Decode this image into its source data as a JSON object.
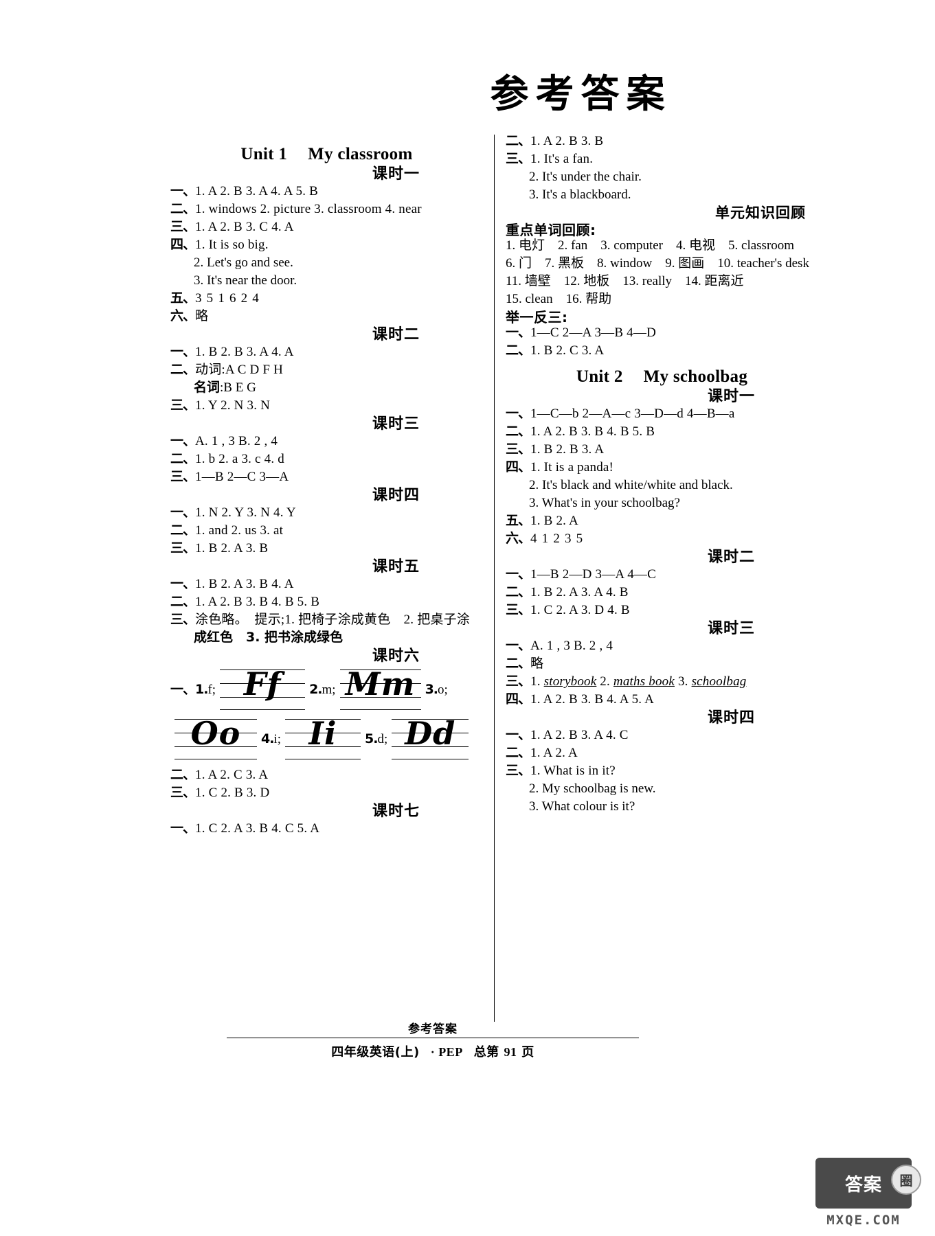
{
  "title": "参考答案",
  "left_column": [
    {
      "kind": "unit",
      "no": "Unit 1",
      "name": "My classroom"
    },
    {
      "kind": "lesson",
      "label": "课时一"
    },
    {
      "kind": "ans",
      "num": "一、",
      "body": "1. A   2. B   3. A   4. A   5. B"
    },
    {
      "kind": "ans",
      "num": "二、",
      "body": "1. windows   2. picture   3. classroom   4. near"
    },
    {
      "kind": "ans",
      "num": "三、",
      "body": "1. A   2. B   3. C   4. A"
    },
    {
      "kind": "ans",
      "num": "四、",
      "body": "1. It is so big."
    },
    {
      "kind": "cont",
      "body": "2. Let's go and see."
    },
    {
      "kind": "cont",
      "body": "3. It's near the door."
    },
    {
      "kind": "ans",
      "num": "五、",
      "body": "3   5   1   6   2   4"
    },
    {
      "kind": "ans_cn",
      "num": "六、",
      "body": "略"
    },
    {
      "kind": "lesson",
      "label": "课时二"
    },
    {
      "kind": "ans",
      "num": "一、",
      "body": "1. B   2. B   3. A   4. A"
    },
    {
      "kind": "ans_mix",
      "num": "二、",
      "cn": "动词",
      "body": ":A   C   D   F   H"
    },
    {
      "kind": "cont_mix",
      "cn": "名词",
      "body": ":B   E   G"
    },
    {
      "kind": "ans",
      "num": "三、",
      "body": "1. Y   2. N   3. N"
    },
    {
      "kind": "lesson",
      "label": "课时三"
    },
    {
      "kind": "ans",
      "num": "一、",
      "body": "A. 1 , 3   B. 2 , 4"
    },
    {
      "kind": "ans",
      "num": "二、",
      "body": "1. b   2. a   3. c   4. d"
    },
    {
      "kind": "ans",
      "num": "三、",
      "body": "1—B   2—C   3—A"
    },
    {
      "kind": "lesson",
      "label": "课时四"
    },
    {
      "kind": "ans",
      "num": "一、",
      "body": "1. N   2. Y   3. N   4. Y"
    },
    {
      "kind": "ans",
      "num": "二、",
      "body": "1. and   2. us   3. at"
    },
    {
      "kind": "ans",
      "num": "三、",
      "body": "1. B   2. A   3. B"
    },
    {
      "kind": "lesson",
      "label": "课时五"
    },
    {
      "kind": "ans",
      "num": "一、",
      "body": "1. B   2. A   3. B   4. A"
    },
    {
      "kind": "ans",
      "num": "二、",
      "body": "1. A   2. B   3. B   4. B   5. B"
    },
    {
      "kind": "ans_cn",
      "num": "三、",
      "body": "涂色略。　提示;1. 把椅子涂成黄色　2. 把桌子涂"
    },
    {
      "kind": "cont_cn",
      "body": "成红色　3. 把书涂成绿色"
    },
    {
      "kind": "lesson",
      "label": "课时六"
    },
    {
      "kind": "handwriting1"
    },
    {
      "kind": "handwriting2"
    },
    {
      "kind": "ans",
      "num": "二、",
      "body": "1. A   2. C   3. A"
    },
    {
      "kind": "ans",
      "num": "三、",
      "body": "1. C   2. B   3. D"
    },
    {
      "kind": "lesson",
      "label": "课时七"
    },
    {
      "kind": "ans",
      "num": "一、",
      "body": "1. C   2. A   3. B   4. C   5. A"
    }
  ],
  "right_column": [
    {
      "kind": "ans",
      "num": "二、",
      "body": "1. A   2. B   3. B"
    },
    {
      "kind": "ans",
      "num": "三、",
      "body": "1. It's a fan."
    },
    {
      "kind": "cont",
      "body": "2. It's under the chair."
    },
    {
      "kind": "cont",
      "body": "3. It's a blackboard."
    },
    {
      "kind": "section",
      "label": "单元知识回顾"
    },
    {
      "kind": "subhead",
      "label": "重点单词回顾:"
    },
    {
      "kind": "vocab",
      "body": "1. 电灯　2. fan　3. computer　4. 电视　5. classroom"
    },
    {
      "kind": "vocab",
      "body": "6. 门　7. 黑板　8. window　9. 图画　10. teacher's desk"
    },
    {
      "kind": "vocab",
      "body": "11. 墙壁　12. 地板　13. really　14. 距离近"
    },
    {
      "kind": "vocab",
      "body": "15. clean　16. 帮助"
    },
    {
      "kind": "subhead",
      "label": "举一反三:"
    },
    {
      "kind": "ans",
      "num": "一、",
      "body": "1—C   2—A   3—B   4—D"
    },
    {
      "kind": "ans",
      "num": "二、",
      "body": "1. B   2. C   3. A"
    },
    {
      "kind": "unit",
      "no": "Unit 2",
      "name": "My schoolbag"
    },
    {
      "kind": "lesson",
      "label": "课时一"
    },
    {
      "kind": "ans",
      "num": "一、",
      "body": "1—C—b   2—A—c   3—D—d   4—B—a"
    },
    {
      "kind": "ans",
      "num": "二、",
      "body": "1. A   2. B   3. B   4. B   5. B"
    },
    {
      "kind": "ans",
      "num": "三、",
      "body": "1. B   2. B   3. A"
    },
    {
      "kind": "ans",
      "num": "四、",
      "body": "1. It is a panda!"
    },
    {
      "kind": "cont",
      "body": "2. It's black and white/white and black."
    },
    {
      "kind": "cont",
      "body": "3. What's in your schoolbag?"
    },
    {
      "kind": "ans",
      "num": "五、",
      "body": "1. B   2. A"
    },
    {
      "kind": "ans",
      "num": "六、",
      "body": "4   1   2   3   5"
    },
    {
      "kind": "lesson",
      "label": "课时二"
    },
    {
      "kind": "ans",
      "num": "一、",
      "body": "1—B   2—D   3—A   4—C"
    },
    {
      "kind": "ans",
      "num": "二、",
      "body": "1. B   2. A   3. A   4. B"
    },
    {
      "kind": "ans",
      "num": "三、",
      "body": "1. C   2. A   3. D   4. B"
    },
    {
      "kind": "lesson",
      "label": "课时三"
    },
    {
      "kind": "ans",
      "num": "一、",
      "body": "A. 1 , 3   B. 2 , 4"
    },
    {
      "kind": "ans_cn",
      "num": "二、",
      "body": "略"
    },
    {
      "kind": "ans_ul",
      "num": "三、",
      "parts": [
        "1. ",
        "storybook",
        "   2. ",
        "maths book",
        "   3. ",
        "schoolbag"
      ]
    },
    {
      "kind": "ans",
      "num": "四、",
      "body": "1. A   2. B   3. B   4. A   5. A"
    },
    {
      "kind": "lesson",
      "label": "课时四"
    },
    {
      "kind": "ans",
      "num": "一、",
      "body": "1. A   2. B   3. A   4. C"
    },
    {
      "kind": "ans",
      "num": "二、",
      "body": "1. A   2. A"
    },
    {
      "kind": "ans",
      "num": "三、",
      "body": "1. What is in it?"
    },
    {
      "kind": "cont",
      "body": "2. My schoolbag is new."
    },
    {
      "kind": "cont",
      "body": "3. What colour is it?"
    }
  ],
  "handwriting": {
    "items": [
      {
        "num": "一、1.",
        "letter": "f;",
        "glyph": "Ff"
      },
      {
        "num": "2.",
        "letter": "m;",
        "glyph": "Mm"
      },
      {
        "num": "3.",
        "letter": "o;",
        "glyph": "Oo"
      },
      {
        "num": "4.",
        "letter": "i;",
        "glyph": "Ii"
      },
      {
        "num": "5.",
        "letter": "d;",
        "glyph": "Dd"
      }
    ]
  },
  "footer": {
    "title": "参考答案",
    "grade": "四年级英语",
    "term": "(上)",
    "edition": "· PEP",
    "total": "总第",
    "page": "91",
    "page_unit": "页"
  },
  "watermark": {
    "box_text": "答案",
    "circle_text": "圈",
    "url_text": "MXQE.COM"
  }
}
